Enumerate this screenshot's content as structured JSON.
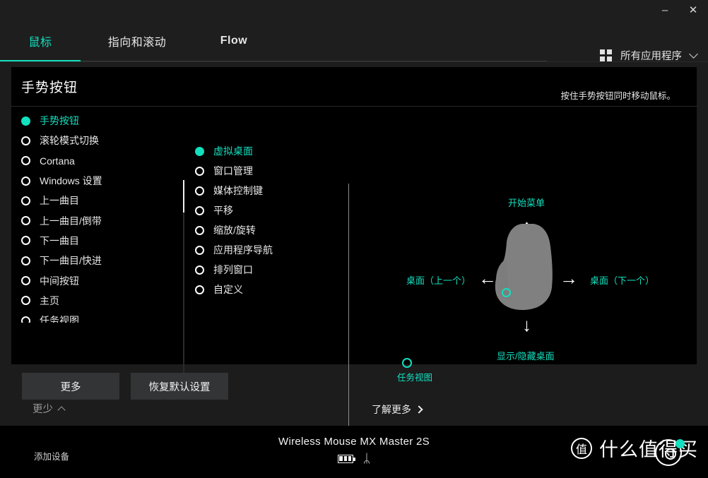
{
  "window": {
    "minimize_label": "–",
    "close_label": "✕"
  },
  "tabs": [
    {
      "label": "鼠标",
      "active": true
    },
    {
      "label": "指向和滚动",
      "active": false
    },
    {
      "label": "Flow",
      "active": false
    }
  ],
  "app_selector": {
    "grid_icon": "grid-icon",
    "label": "所有应用程序",
    "chevron": "chevron-down-icon"
  },
  "panel": {
    "title": "手势按钮",
    "description": "按住手势按钮同时移动鼠标。"
  },
  "left_list": {
    "items": [
      {
        "label": "手势按钮",
        "selected": true
      },
      {
        "label": "滚轮模式切换",
        "selected": false
      },
      {
        "label": "Cortana",
        "selected": false
      },
      {
        "label": "Windows 设置",
        "selected": false
      },
      {
        "label": "上一曲目",
        "selected": false
      },
      {
        "label": "上一曲目/倒带",
        "selected": false
      },
      {
        "label": "下一曲目",
        "selected": false
      },
      {
        "label": "下一曲目/快进",
        "selected": false
      },
      {
        "label": "中间按钮",
        "selected": false
      },
      {
        "label": "主页",
        "selected": false
      },
      {
        "label": "任务视图",
        "selected": false
      }
    ],
    "show_less_label": "更少",
    "show_less_chevron": "chevron-up-icon"
  },
  "mid_list": {
    "items": [
      {
        "label": "虚拟桌面",
        "selected": true
      },
      {
        "label": "窗口管理",
        "selected": false
      },
      {
        "label": "媒体控制键",
        "selected": false
      },
      {
        "label": "平移",
        "selected": false
      },
      {
        "label": "缩放/旋转",
        "selected": false
      },
      {
        "label": "应用程序导航",
        "selected": false
      },
      {
        "label": "排列窗口",
        "selected": false
      },
      {
        "label": "自定义",
        "selected": false
      }
    ]
  },
  "diagram": {
    "up_label": "开始菜单",
    "left_label": "桌面（上一个）",
    "right_label": "桌面（下一个）",
    "down_label": "显示/隐藏桌面",
    "task_view_label": "任务视图",
    "arrow_up": "↑",
    "arrow_down": "↓",
    "arrow_left": "←",
    "arrow_right": "→",
    "learn_more_label": "了解更多",
    "learn_more_chevron": "chevron-right-icon"
  },
  "actions": {
    "more_label": "更多",
    "reset_label": "恢复默认设置"
  },
  "bottom": {
    "add_device_label": "添加设备",
    "device_name": "Wireless Mouse MX Master 2S",
    "battery_icon": "battery-icon",
    "bluetooth_icon": "ᛦ",
    "watermark_badge": "值",
    "watermark_text": "什么值得买"
  },
  "colors": {
    "accent": "#12e0bf",
    "panel_bg": "#000000",
    "frame_bg": "#1e1e1e",
    "button_bg": "#333436",
    "mouse_gray": "#808080"
  }
}
